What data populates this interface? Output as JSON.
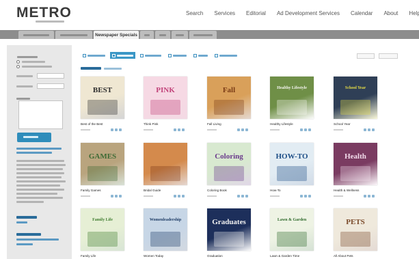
{
  "brand": {
    "logo_text": "METRO"
  },
  "top_nav": [
    "Search",
    "Services",
    "Editorial",
    "Ad Development Services",
    "Calendar",
    "About",
    "Help"
  ],
  "tabs": {
    "active_label": "Newspaper Specials"
  },
  "products": [
    {
      "label": "Best of the Best",
      "cover_title": "BEST",
      "cover_bg": "#efe7d2",
      "accent": "#2d2d2d"
    },
    {
      "label": "Think Pink",
      "cover_title": "PINK",
      "cover_bg": "#f6d9e4",
      "accent": "#c2437a"
    },
    {
      "label": "Fall Living",
      "cover_title": "Fall",
      "cover_bg": "#d9a05a",
      "accent": "#7b3c16"
    },
    {
      "label": "Healthy Lifestyle",
      "cover_title": "Healthy Lifestyle",
      "cover_bg": "#6f8f47",
      "accent": "#f5f5f0"
    },
    {
      "label": "School Year",
      "cover_title": "School Year",
      "cover_bg": "#2f3f56",
      "accent": "#e6dd45"
    },
    {
      "label": "Family Games",
      "cover_title": "GAMES",
      "cover_bg": "#b9a47e",
      "accent": "#3e6b35"
    },
    {
      "label": "Bridal Guide",
      "cover_title": "",
      "cover_bg": "#d48a4c",
      "accent": "#7d3a1a"
    },
    {
      "label": "Coloring Book",
      "cover_title": "Coloring",
      "cover_bg": "#d8e9d0",
      "accent": "#6a3a8b"
    },
    {
      "label": "How-To",
      "cover_title": "HOW-TO",
      "cover_bg": "#e2ecf3",
      "accent": "#1c4d86"
    },
    {
      "label": "Health & Wellness",
      "cover_title": "Health",
      "cover_bg": "#7a3b61",
      "accent": "#f2dceb"
    },
    {
      "label": "Family Life",
      "cover_title": "Family Life",
      "cover_bg": "#e6efd5",
      "accent": "#3f7d2f"
    },
    {
      "label": "Women Today",
      "cover_title": "Womenleadership",
      "cover_bg": "#c7d6e6",
      "accent": "#1e3c66"
    },
    {
      "label": "Graduation",
      "cover_title": "Graduates",
      "cover_bg": "#1d2f5b",
      "accent": "#f2f2f2"
    },
    {
      "label": "Lawn & Garden Time",
      "cover_title": "Lawn & Garden",
      "cover_bg": "#eef3e4",
      "accent": "#2e6a2b"
    },
    {
      "label": "All About Pets",
      "cover_title": "PETS",
      "cover_bg": "#efe9dc",
      "accent": "#7a4a2a"
    }
  ]
}
